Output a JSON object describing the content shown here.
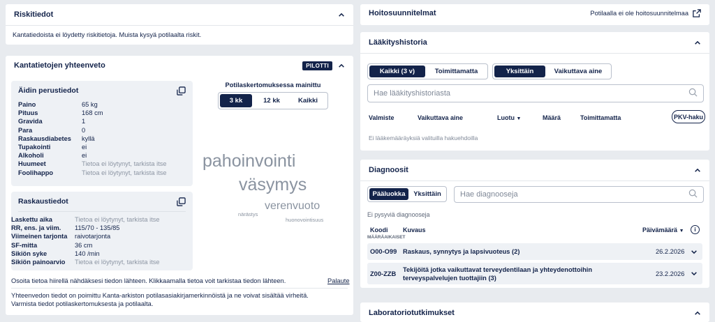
{
  "risk": {
    "title": "Riskitiedot",
    "message": "Kantatiedoista ei löydetty riskitietoja. Muista kysyä potilaalta riskit."
  },
  "summary": {
    "title": "Kantatietojen yhteenveto",
    "badge": "PILOTTI",
    "mother": {
      "title": "Äidin perustiedot",
      "rows": [
        {
          "k": "Paino",
          "v": "65 kg"
        },
        {
          "k": "Pituus",
          "v": "168 cm"
        },
        {
          "k": "Gravida",
          "v": "1"
        },
        {
          "k": "Para",
          "v": "0"
        },
        {
          "k": "Raskausdiabetes",
          "v": "kyllä"
        },
        {
          "k": "Tupakointi",
          "v": "ei"
        },
        {
          "k": "Alkoholi",
          "v": "ei"
        },
        {
          "k": "Huumeet",
          "v": "Tietoa ei löytynyt, tarkista itse"
        },
        {
          "k": "Foolihappo",
          "v": "Tietoa ei löytynyt, tarkista itse"
        }
      ]
    },
    "pregnancy": {
      "title": "Raskaustiedot",
      "rows": [
        {
          "k": "Laskettu aika",
          "v": "Tietoa ei löytynyt, tarkista itse"
        },
        {
          "k": "RR, ens. ja viim.",
          "v": "115/70 - 135/85"
        },
        {
          "k": "Viimeinen tarjonta",
          "v": "raivotarjonta"
        },
        {
          "k": "SF-mitta",
          "v": "36 cm"
        },
        {
          "k": "Sikiön syke",
          "v": "140 /min"
        },
        {
          "k": "Sikiön painoarvio",
          "v": "Tietoa ei löytynyt, tarkista itse"
        }
      ]
    },
    "mentions": {
      "title": "Potilaskertomuksessa mainittu",
      "tabs": [
        "3 kk",
        "12 kk",
        "Kaikki"
      ],
      "words": [
        "pahoinvointi",
        "väsymys",
        "verenvuoto",
        "närästys",
        "huonovointisuus"
      ]
    },
    "hint": "Osoita tietoa hiirellä nähdäksesi tiedon lähteen. Klikkaamalla tietoa voit tarkistaa tiedon lähteen.",
    "feedback": "Palaute",
    "disclaimer1": "Yhteenvedon tiedot on poimittu Kanta-arkiston potilasasiakirjamerkinnöistä ja ne voivat sisältää virheitä.",
    "disclaimer2": "Varmista tiedot potilaskertomuksesta ja potilaalta."
  },
  "care_plan": {
    "title": "Hoitosuunnitelmat",
    "link": "Potilaalla ei ole hoitosuunnitelmaa"
  },
  "med_history": {
    "title": "Lääkityshistoria",
    "filter1": [
      "Kaikki (3 v)",
      "Toimittamatta"
    ],
    "filter2": [
      "Yksittäin",
      "Vaikuttava aine"
    ],
    "search_placeholder": "Hae lääkityshistoriasta",
    "columns": [
      "Valmiste",
      "Vaikuttava aine",
      "Luotu",
      "Määrä",
      "Toimittamatta"
    ],
    "pkv_button": "PKV-haku",
    "empty": "Ei lääkemääräyksiä valituilla hakuehdoilla"
  },
  "diagnoses": {
    "title": "Diagnoosit",
    "tabs": [
      "Pääluokka",
      "Yksittäin"
    ],
    "search_placeholder": "Hae diagnooseja",
    "no_permanent": "Ei pysyviä diagnooseja",
    "col_code": "Koodi",
    "col_code_sub": "MÄÄRÄAIKAISET",
    "col_desc": "Kuvaus",
    "col_date": "Päivämäärä",
    "rows": [
      {
        "code": "O00-O99",
        "desc": "Raskaus, synnytys ja lapsivuoteus (2)",
        "date": "26.2.2026"
      },
      {
        "code": "Z00-ZZB",
        "desc": "Tekijöitä jotka vaikuttavat terveydentilaan ja yhteydenottoihin terveyspalvelujen tuottajiin (3)",
        "date": "23.2.2026"
      }
    ]
  },
  "lab": {
    "title": "Laboratoriotutkimukset"
  }
}
